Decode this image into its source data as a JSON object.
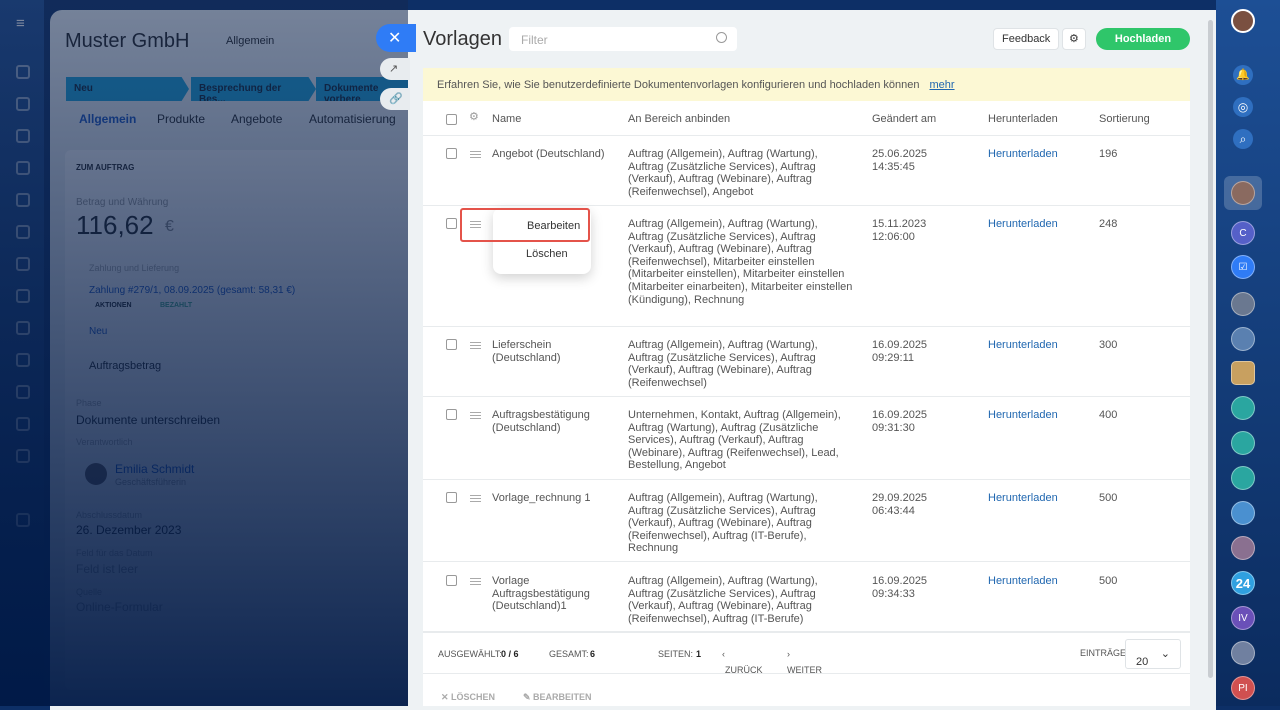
{
  "background": {
    "company": "Muster GmbH",
    "category": "Allgemein",
    "stages": [
      "Neu",
      "Besprechung der Bes...",
      "Dokumente vorbere"
    ],
    "tabs": [
      "Allgemein",
      "Produkte",
      "Angebote",
      "Automatisierung"
    ],
    "section": "ZUM AUFTRAG",
    "amount_label": "Betrag und Währung",
    "amount": "116,62",
    "currency": "€",
    "payment_title": "Zahlung und Lieferung",
    "payment": "Zahlung #279/1, 08.09.2025 (gesamt: 58,31 €)",
    "actions": "AKTIONEN",
    "paid": "BEZAHLT",
    "new_link": "Neu",
    "order_amount": "Auftragsbetrag",
    "phase_label": "Phase",
    "phase": "Dokumente unterschreiben",
    "resp_label": "Verantwortlich",
    "resp_name": "Emilia Schmidt",
    "resp_role": "Geschäftsführerin",
    "close_label": "Abschlussdatum",
    "close_date": "26. Dezember 2023",
    "date_field_label": "Feld für das Datum",
    "date_field": "Feld ist leer",
    "source_label": "Quelle",
    "source": "Online-Formular"
  },
  "panel": {
    "title": "Vorlagen",
    "filter_placeholder": "Filter",
    "feedback": "Feedback",
    "upload": "Hochladen",
    "banner": "Erfahren Sie, wie Sie benutzerdefinierte Dokumentenvorlagen konfigurieren und hochladen können",
    "banner_link": "mehr",
    "columns": [
      "Name",
      "An Bereich anbinden",
      "Geändert am",
      "Herunterladen",
      "Sortierung"
    ],
    "rows": [
      {
        "name": "Angebot (Deutschland)",
        "scope": "Auftrag (Allgemein), Auftrag (Wartung), Auftrag (Zusätzliche Services), Auftrag (Verkauf), Auftrag (Webinare), Auftrag (Reifenwechsel), Angebot",
        "date": "25.06.2025 14:35:45",
        "download": "Herunterladen",
        "sort": "196"
      },
      {
        "name": "",
        "scope": "Auftrag (Allgemein), Auftrag (Wartung), Auftrag (Zusätzliche Services), Auftrag (Verkauf), Auftrag (Webinare), Auftrag (Reifenwechsel), Mitarbeiter einstellen (Mitarbeiter einstellen), Mitarbeiter einstellen (Mitarbeiter einarbeiten), Mitarbeiter einstellen (Kündigung), Rechnung",
        "date": "15.11.2023 12:06:00",
        "download": "Herunterladen",
        "sort": "248"
      },
      {
        "name": "Lieferschein (Deutschland)",
        "scope": "Auftrag (Allgemein), Auftrag (Wartung), Auftrag (Zusätzliche Services), Auftrag (Verkauf), Auftrag (Webinare), Auftrag (Reifenwechsel)",
        "date": "16.09.2025 09:29:11",
        "download": "Herunterladen",
        "sort": "300"
      },
      {
        "name": "Auftragsbestätigung (Deutschland)",
        "scope": "Unternehmen, Kontakt, Auftrag (Allgemein), Auftrag (Wartung), Auftrag (Zusätzliche Services), Auftrag (Verkauf), Auftrag (Webinare), Auftrag (Reifenwechsel), Lead, Bestellung, Angebot",
        "date": "16.09.2025 09:31:30",
        "download": "Herunterladen",
        "sort": "400"
      },
      {
        "name": "Vorlage_rechnung 1",
        "scope": "Auftrag (Allgemein), Auftrag (Wartung), Auftrag (Zusätzliche Services), Auftrag (Verkauf), Auftrag (Webinare), Auftrag (Reifenwechsel), Auftrag (IT-Berufe), Rechnung",
        "date": "29.09.2025 06:43:44",
        "download": "Herunterladen",
        "sort": "500"
      },
      {
        "name": "Vorlage Auftragsbestätigung (Deutschland)1",
        "scope": "Auftrag (Allgemein), Auftrag (Wartung), Auftrag (Zusätzliche Services), Auftrag (Verkauf), Auftrag (Webinare), Auftrag (Reifenwechsel), Auftrag (IT-Berufe)",
        "date": "16.09.2025 09:34:33",
        "download": "Herunterladen",
        "sort": "500"
      }
    ],
    "context_menu": {
      "edit": "Bearbeiten",
      "delete": "Löschen"
    },
    "footer": {
      "selected_label": "AUSGEWÄHLT:",
      "selected": "0 / 6",
      "total_label": "GESAMT:",
      "total": "6",
      "pages_label": "SEITEN:",
      "page": "1",
      "prev": "ZURÜCK",
      "next": "WEITER",
      "entries_label": "EINTRÄGE",
      "entries": "20"
    },
    "actions": {
      "delete": "LÖSCHEN",
      "edit": "BEARBEITEN"
    }
  },
  "rightbar": {
    "badges": [
      "C",
      "24",
      "IV",
      "PI"
    ]
  }
}
